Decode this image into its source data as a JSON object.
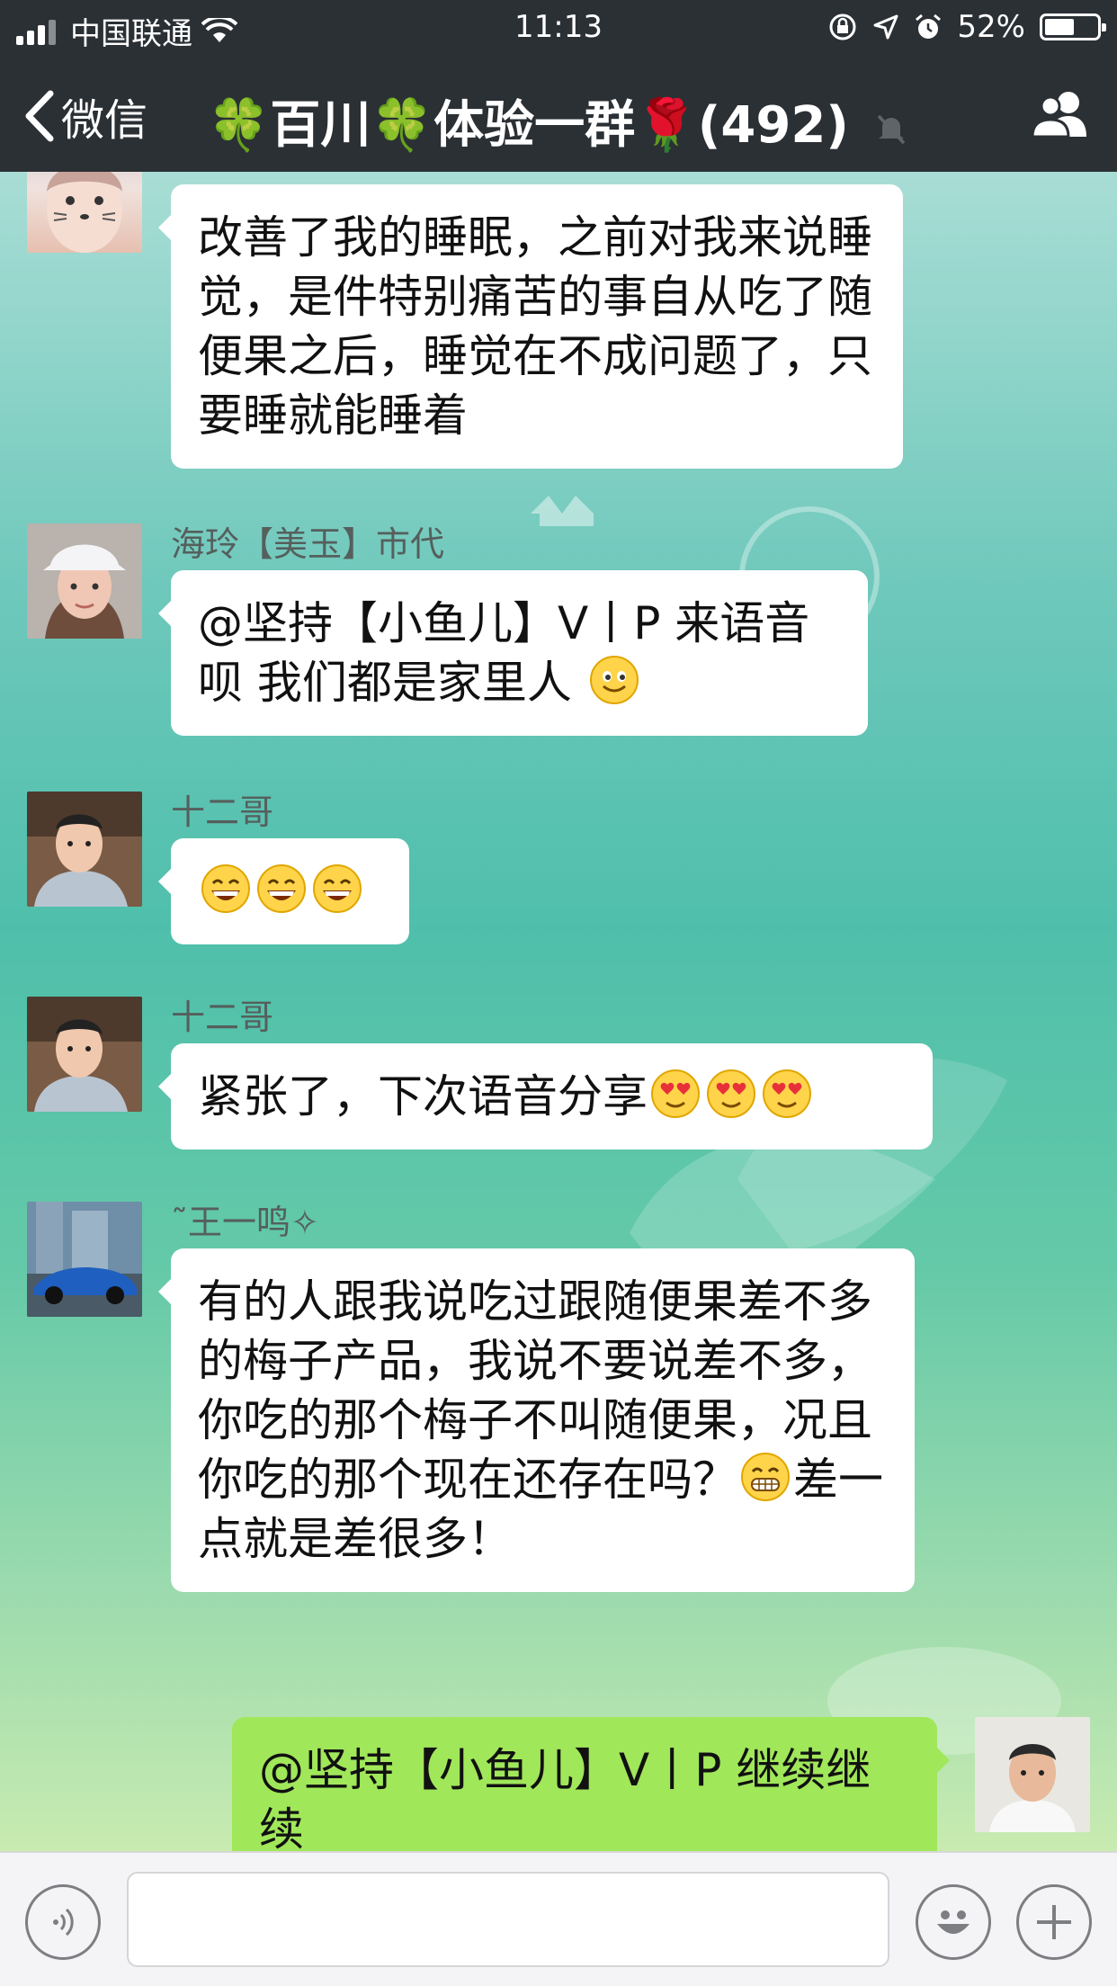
{
  "status_bar": {
    "carrier": "中国联通",
    "time": "11:13",
    "battery": "52%",
    "battery_level": 0.52
  },
  "nav": {
    "back_label": "微信",
    "title": "🍀百川🍀体验一群🌹(492)",
    "muted": true
  },
  "messages": [
    {
      "side": "left",
      "sender": "",
      "avatar": "cartoon-face-avatar",
      "text": "改善了我的睡眠，之前对我来说睡觉，是件特别痛苦的事自从吃了随便果之后，睡觉在不成问题了，只要睡就能睡着"
    },
    {
      "side": "left",
      "sender": "海玲【美玉】市代",
      "avatar": "woman-white-cap-avatar",
      "text": "@坚持【小鱼儿】V丨P 来语音呗 我们都是家里人",
      "emojis": [
        "smile"
      ]
    },
    {
      "side": "left",
      "sender": "十二哥",
      "avatar": "man-photo-avatar",
      "text": "",
      "emojis": [
        "grin",
        "grin",
        "grin"
      ]
    },
    {
      "side": "left",
      "sender": "十二哥",
      "avatar": "man-photo-avatar",
      "text": "紧张了，下次语音分享",
      "emojis": [
        "heart-eyes",
        "heart-eyes",
        "heart-eyes"
      ]
    },
    {
      "side": "left",
      "sender": "王一鸣",
      "avatar": "blue-car-avatar",
      "text_before": "有的人跟我说吃过跟随便果差不多的梅子产品，我说不要说差不多，你吃的那个梅子不叫随便果，况且你吃的那个现在还存在吗？",
      "emojis": [
        "grimace"
      ],
      "text_after": "差一点就是差很多！"
    },
    {
      "side": "right",
      "sender": "",
      "avatar": "young-man-avatar",
      "text": "@坚持【小鱼儿】V丨P 继续继续"
    }
  ],
  "input_bar": {
    "text_value": ""
  },
  "colors": {
    "nav_bg": "#2b3035",
    "bubble_left": "#ffffff",
    "bubble_right": "#a0e75a",
    "chat_bg_top": "#a8ddd5",
    "chat_bg_bottom": "#c8ebb0"
  }
}
